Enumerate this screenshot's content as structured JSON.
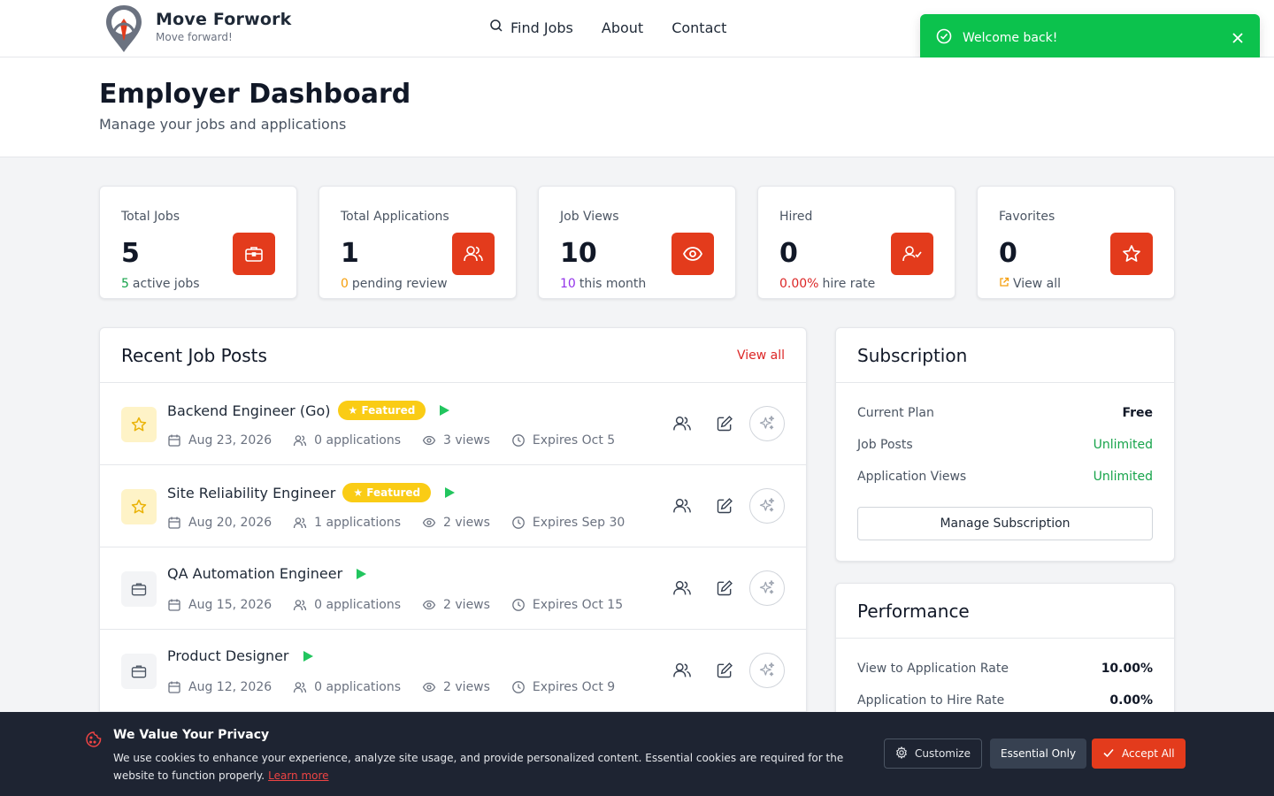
{
  "brand": {
    "name": "Move Forwork",
    "tagline": "Move forward!"
  },
  "nav": {
    "find_jobs": "Find Jobs",
    "about": "About",
    "contact": "Contact"
  },
  "toast": {
    "message": "Welcome back!"
  },
  "page": {
    "title": "Employer Dashboard",
    "subtitle": "Manage your jobs and applications"
  },
  "stats": [
    {
      "label": "Total Jobs",
      "value": "5",
      "foot_num": "5",
      "foot_text": "active jobs",
      "icon": "briefcase-icon"
    },
    {
      "label": "Total Applications",
      "value": "1",
      "foot_num": "0",
      "foot_text": "pending review",
      "icon": "users-icon"
    },
    {
      "label": "Job Views",
      "value": "10",
      "foot_num": "10",
      "foot_text": "this month",
      "icon": "eye-icon"
    },
    {
      "label": "Hired",
      "value": "0",
      "foot_num": "0.00%",
      "foot_text": "hire rate",
      "icon": "user-check-icon"
    },
    {
      "label": "Favorites",
      "value": "0",
      "foot_text": "View all",
      "icon": "star-icon"
    }
  ],
  "recent_jobs": {
    "title": "Recent Job Posts",
    "view_all": "View all",
    "items": [
      {
        "title": "Backend Engineer (Go)",
        "featured": "★ Featured",
        "date": "Aug 23, 2026",
        "applications": "0 applications",
        "views": "3 views",
        "expires": "Expires Oct 5"
      },
      {
        "title": "Site Reliability Engineer",
        "featured": "★ Featured",
        "date": "Aug 20, 2026",
        "applications": "1 applications",
        "views": "2 views",
        "expires": "Expires Sep 30"
      },
      {
        "title": "QA Automation Engineer",
        "featured": "",
        "date": "Aug 15, 2026",
        "applications": "0 applications",
        "views": "2 views",
        "expires": "Expires Oct 15"
      },
      {
        "title": "Product Designer",
        "featured": "",
        "date": "Aug 12, 2026",
        "applications": "0 applications",
        "views": "2 views",
        "expires": "Expires Oct 9"
      }
    ]
  },
  "subscription": {
    "title": "Subscription",
    "rows": [
      {
        "label": "Current Plan",
        "value": "Free"
      },
      {
        "label": "Job Posts",
        "value": "Unlimited"
      },
      {
        "label": "Application Views",
        "value": "Unlimited"
      }
    ],
    "button": "Manage Subscription"
  },
  "performance": {
    "title": "Performance",
    "rows": [
      {
        "label": "View to Application Rate",
        "value": "10.00%"
      },
      {
        "label": "Application to Hire Rate",
        "value": "0.00%"
      }
    ]
  },
  "cookie": {
    "title": "We Value Your Privacy",
    "text": "We use cookies to enhance your experience, analyze site usage, and provide personalized content. Essential cookies are required for the website to function properly.",
    "learn_more": "Learn more",
    "customize": "Customize",
    "essential": "Essential Only",
    "accept": "Accept All"
  },
  "colors": {
    "accent": "#e33b1c",
    "success": "#0cc24d",
    "featured": "#facc15",
    "cookie_bg": "#1e2432"
  }
}
